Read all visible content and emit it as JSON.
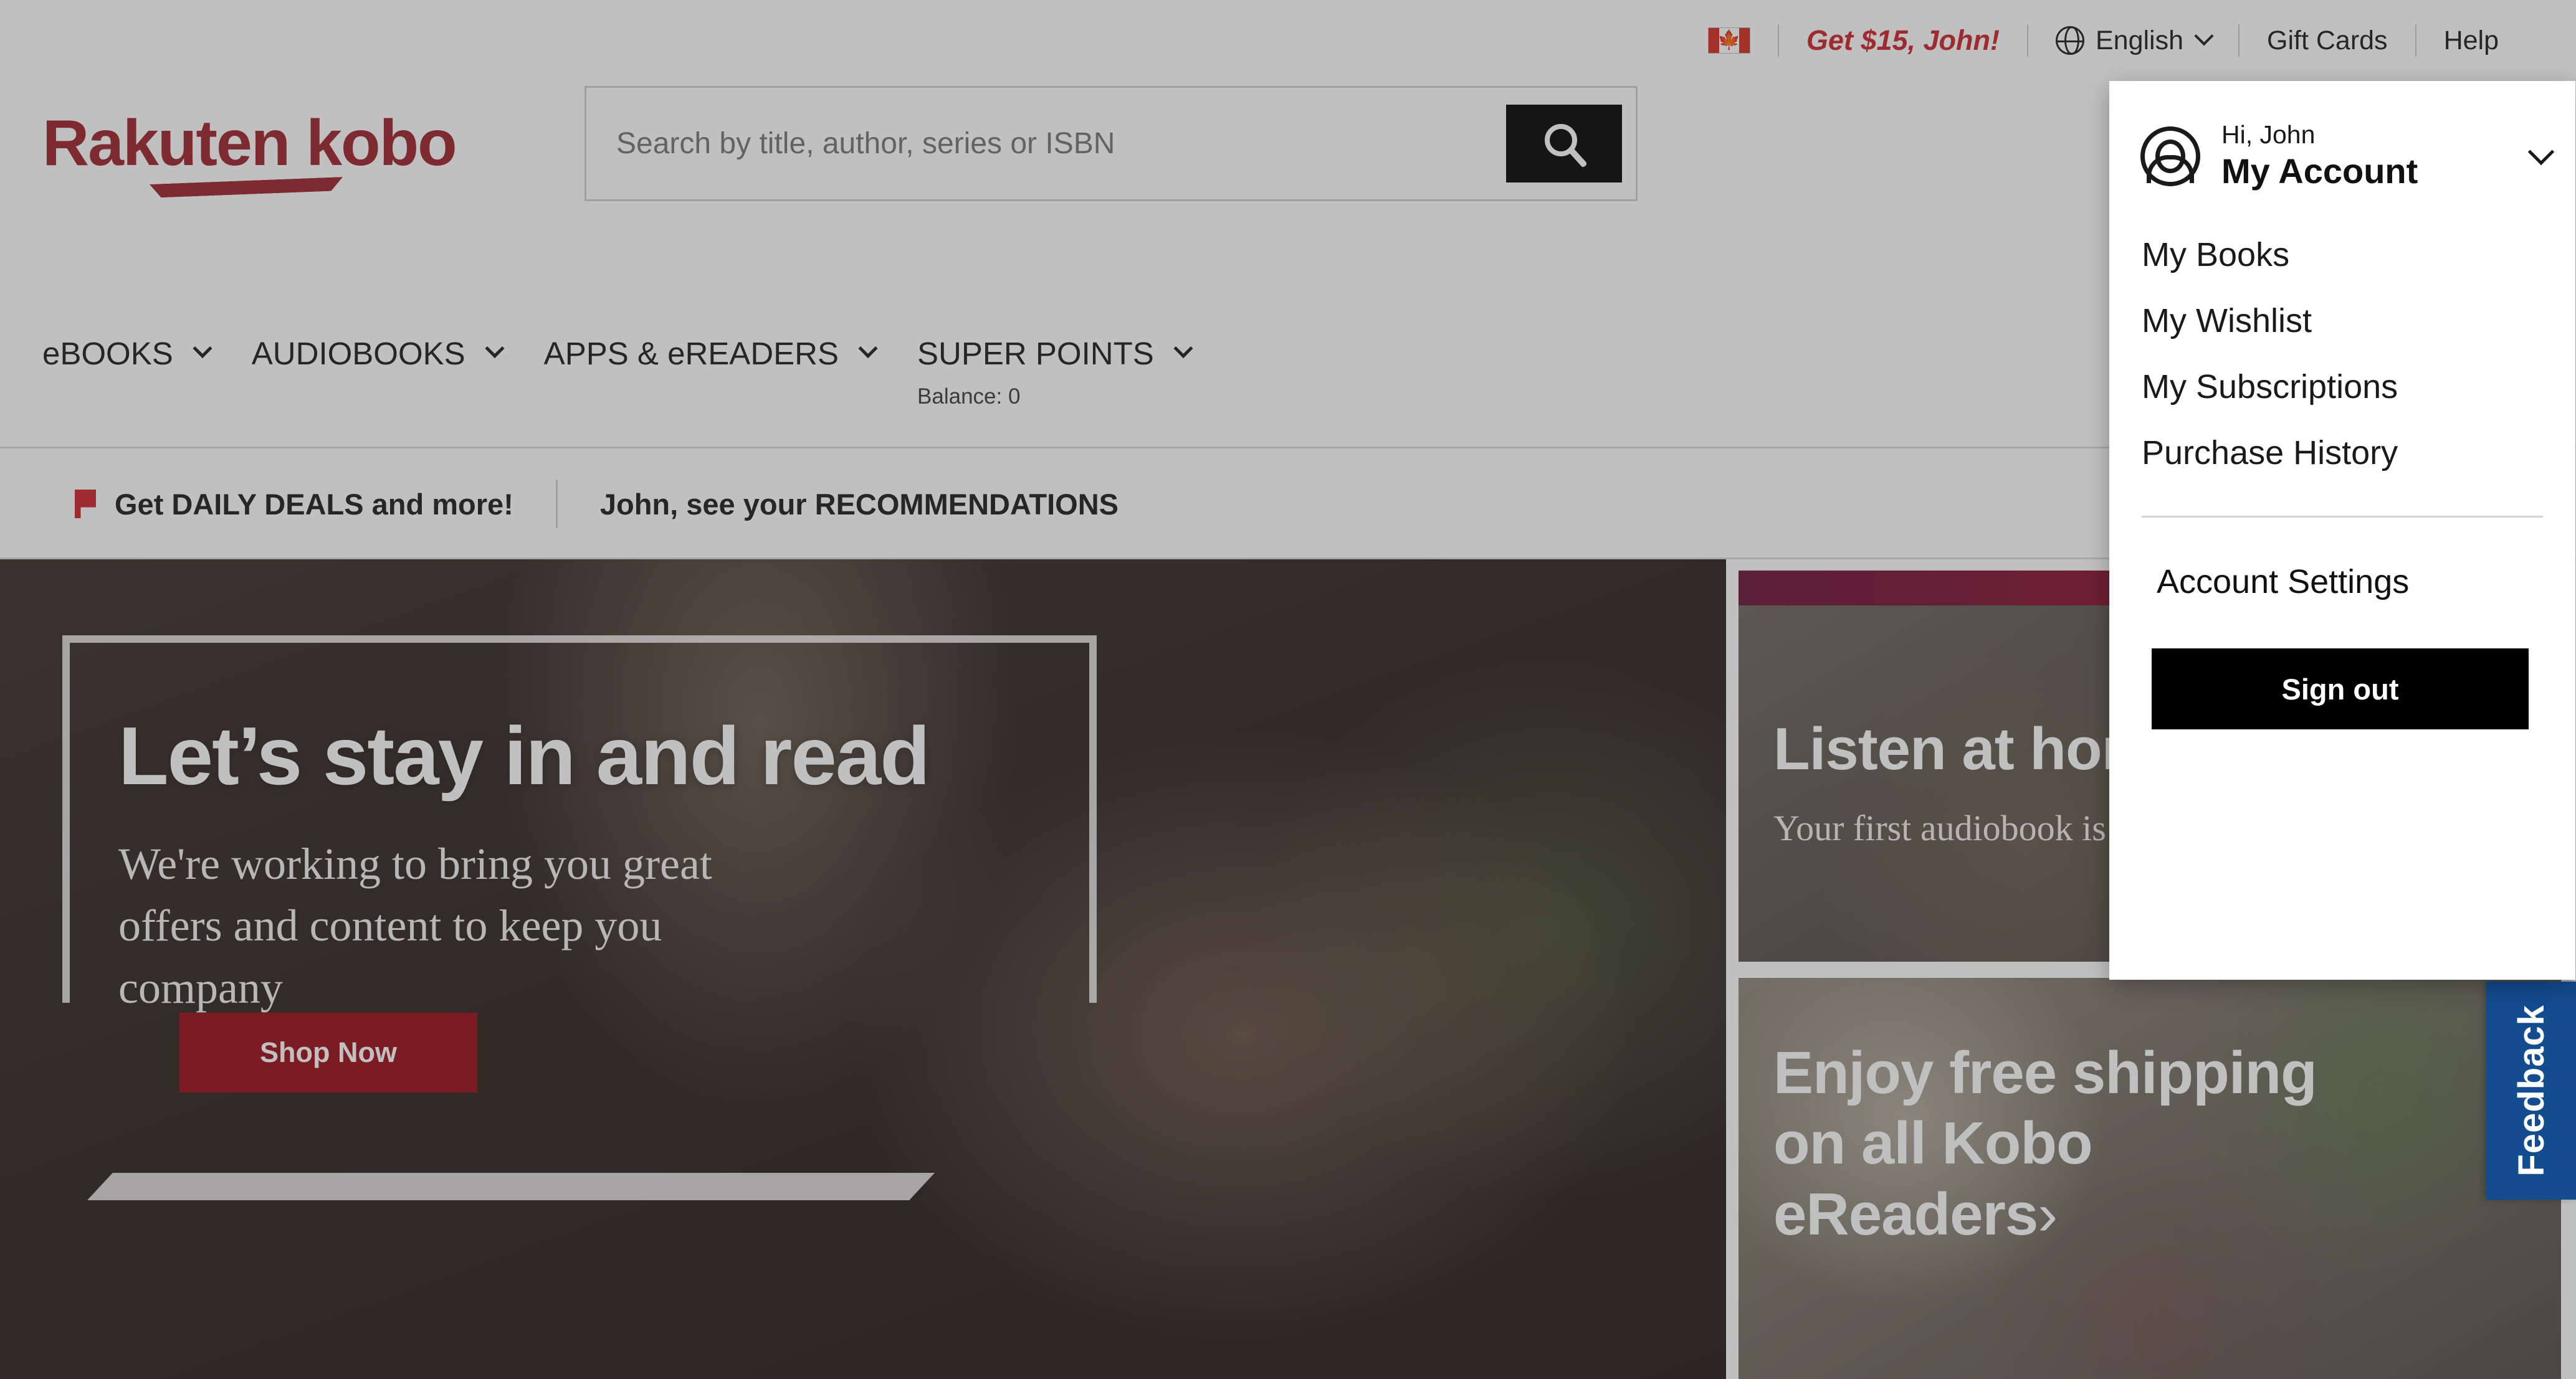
{
  "utility_bar": {
    "flag": "canada-flag",
    "promo_label": "Get $15, John!",
    "language_label": "English",
    "gift_cards_label": "Gift Cards",
    "help_label": "Help"
  },
  "masthead": {
    "logo_text": "Rakuten kobo",
    "search_placeholder": "Search by title, author, series or ISBN",
    "search_value": ""
  },
  "main_nav": {
    "items": [
      {
        "label": "eBOOKS"
      },
      {
        "label": "AUDIOBOOKS"
      },
      {
        "label": "APPS & eREADERS"
      },
      {
        "label": "SUPER POINTS",
        "sub": "Balance: 0"
      }
    ]
  },
  "deals_strip": {
    "daily_deals_label": "Get DAILY DEALS and more!",
    "recommendations_label": "John, see your RECOMMENDATIONS"
  },
  "hero": {
    "title": "Let’s stay in and read",
    "subtitle": "We're working to bring you great offers and content to keep you company",
    "cta_label": "Shop Now"
  },
  "cards": {
    "audiobook": {
      "title": "Listen at home",
      "subtitle": "Your first audiobook is free"
    },
    "shipping": {
      "title": "Enjoy free shipping on all Kobo eReaders",
      "arrow": "›"
    }
  },
  "feedback": {
    "label": "Feedback"
  },
  "account_dropdown": {
    "greeting": "Hi, John",
    "title": "My Account",
    "links": [
      {
        "label": "My Books"
      },
      {
        "label": "My Wishlist"
      },
      {
        "label": "My Subscriptions"
      },
      {
        "label": "Purchase History"
      }
    ],
    "account_settings_label": "Account Settings",
    "sign_out_label": "Sign out"
  },
  "colors": {
    "brand_red": "#9C2029",
    "promo_red": "#cc2229",
    "cta_red": "#9C0A14",
    "feedback_blue": "#134C8F",
    "card_accent": "#8a0e2c",
    "black": "#000000"
  }
}
